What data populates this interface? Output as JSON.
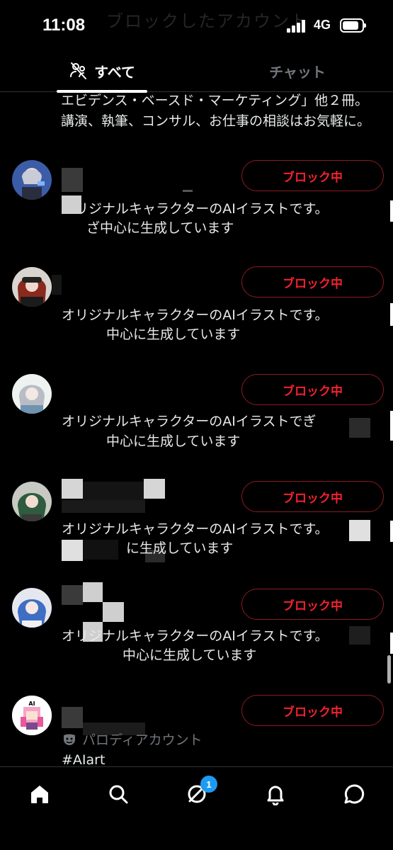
{
  "status": {
    "time": "11:08",
    "network": "4G",
    "ghost_title": "ブロックしたアカウント"
  },
  "tabs": [
    {
      "label": "すべて"
    },
    {
      "label": "チャット"
    }
  ],
  "bio_top": {
    "line1": "エビデンス・ベースド・マーケティング」他２冊。",
    "line2": "講演、執筆、コンサル、お仕事の相談はお気軽に。"
  },
  "users": [
    {
      "button": "ブロック中",
      "bio_line1": "オリジナルキャラクターのAIイラストです。",
      "bio_line2": "ざ中心に生成しています"
    },
    {
      "button": "ブロック中",
      "bio_line1": "オリジナルキャラクターのAIイラストです。",
      "bio_line2": "中心に生成しています"
    },
    {
      "button": "ブロック中",
      "bio_line1": "オリジナルキャラクターのAIイラストでぎ",
      "bio_line2": "中心に生成しています"
    },
    {
      "button": "ブロック中",
      "bio_line1": "オリジナルキャラクターのAIイラストです。",
      "bio_line2": "に生成しています"
    },
    {
      "button": "ブロック中",
      "bio_line1": "オリジナルキャラクターのAIイラストです。",
      "bio_line2": "中心に生成しています"
    },
    {
      "button": "ブロック中",
      "parody": "パロディアカウント",
      "hashtag": "#AIart",
      "avatar_text": "AI"
    }
  ],
  "bottom_nav": {
    "messages_badge": "1"
  },
  "colors": {
    "block_red": "#f4212e",
    "block_border": "#8b1c23",
    "badge_blue": "#1d9bf0",
    "muted": "#71767b"
  },
  "icons": [
    "people-off-icon",
    "home-icon",
    "search-icon",
    "grok-icon",
    "bell-icon",
    "message-icon",
    "parody-mask-icon"
  ]
}
